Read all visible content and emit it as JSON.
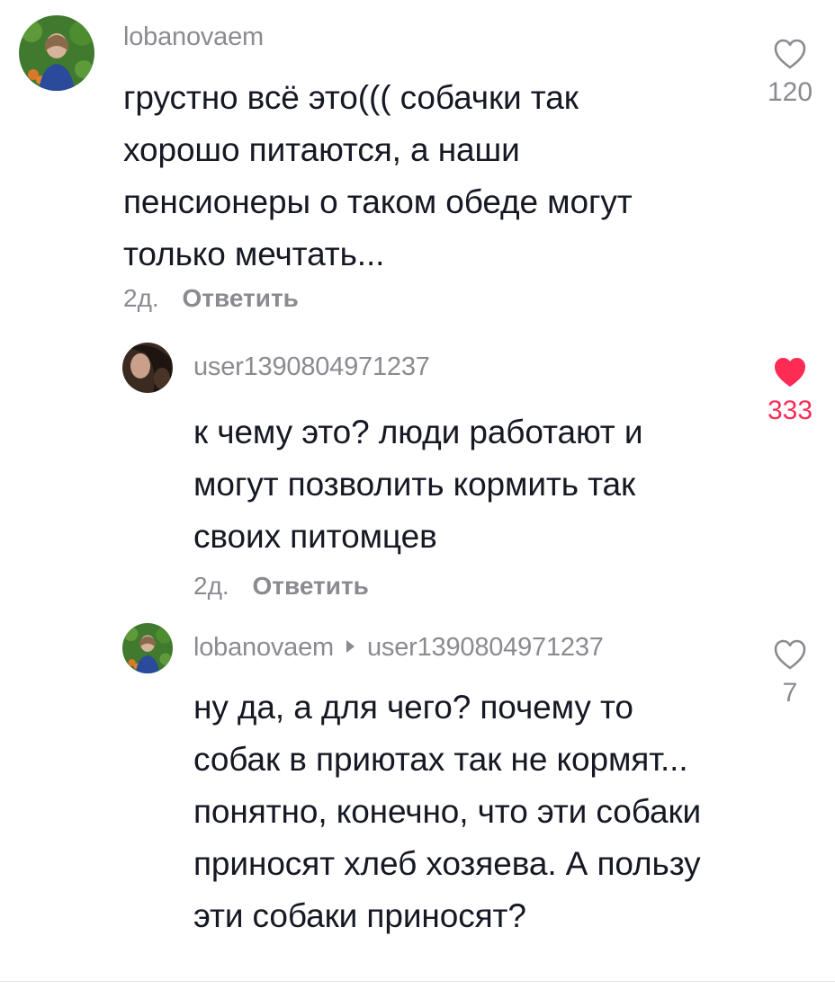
{
  "comments": [
    {
      "username": "lobanovaem",
      "text": "грустно всё это((( собачки так хорошо питаются, а наши пенсионеры о таком обеде могут только мечтать...",
      "time": "2д.",
      "reply_label": "Ответить",
      "likes": "120",
      "liked": false
    },
    {
      "username": "user1390804971237",
      "text": "к чему это? люди работают и могут позволить кормить так своих питомцев",
      "time": "2д.",
      "reply_label": "Ответить",
      "likes": "333",
      "liked": true
    },
    {
      "username": "lobanovaem",
      "reply_to": "user1390804971237",
      "text": "ну да, а для чего? почему то собак в приютах так не кормят... понятно, конечно, что эти собаки приносят хлеб хозяева. А пользу эти собаки приносят?",
      "likes": "7",
      "liked": false
    }
  ],
  "colors": {
    "text": "#161823",
    "muted": "#8a8b91",
    "like_active": "#fe2c55"
  },
  "icons": {
    "like": "heart-outline-icon",
    "liked": "heart-filled-icon",
    "reply_arrow": "caret-right-icon"
  }
}
